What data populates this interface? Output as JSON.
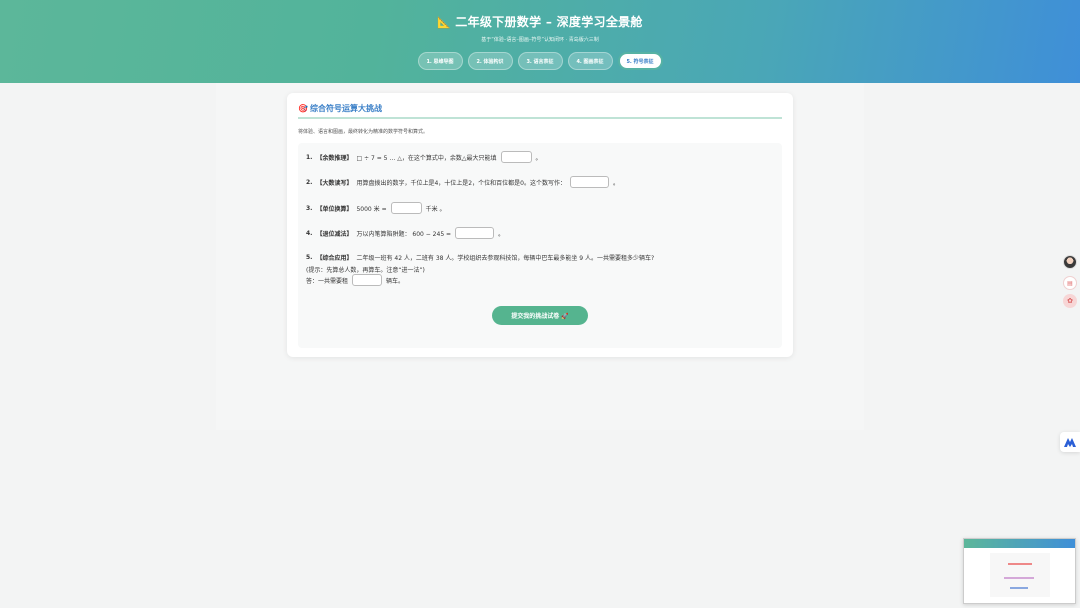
{
  "header": {
    "icon": "triangle-ruler-icon",
    "title": "二年级下册数学 – 深度学习全景舱",
    "subtitle": "基于“体验–语言–图画–符号”认知闭环 · 青岛版六三制"
  },
  "tabs": [
    {
      "label": "1. 思维导图"
    },
    {
      "label": "2. 体验构识"
    },
    {
      "label": "3. 语言表征"
    },
    {
      "label": "4. 图画表征"
    },
    {
      "label": "5. 符号表征"
    }
  ],
  "card": {
    "icon": "dart-icon",
    "title": "综合符号运算大挑战",
    "intro": "将体验、语言和图画，最终转化为精准的数学符号和算式。"
  },
  "questions": {
    "q1": {
      "num": "1.",
      "tag": "【余数推理】",
      "text": "□ ÷ 7 = 5 … △，在这个算式中，余数△最大只能填",
      "end": "。"
    },
    "q2": {
      "num": "2.",
      "tag": "【大数读写】",
      "text": "用算盘拨出的数字，千位上是4，十位上是2，个位和百位都是0。这个数写作：",
      "end": "。"
    },
    "q3": {
      "num": "3.",
      "tag": "【单位换算】",
      "text": "5000 米 =",
      "end": "千米 。"
    },
    "q4": {
      "num": "4.",
      "tag": "【退位减法】",
      "text": "万以内笔算陷阱题： 600 − 245 =",
      "end": "。"
    },
    "q5": {
      "num": "5.",
      "tag": "【综合应用】",
      "text": "二年级一班有 42 人，二班有 38 人。学校组织去参观科技馆，每辆中巴车最多能坐 9 人。一共需要租多少辆车?",
      "hint": "(提示：先算总人数，再算车。注意“进一法”)",
      "answer_prefix": "答：一共需要租",
      "answer_suffix": "辆车。"
    }
  },
  "submit_label": "提交我的挑战试卷 🚀",
  "sidebar": {
    "avatar": "avatar",
    "doc_icon": "doc-icon",
    "tool_icon": "toolbox-icon",
    "logo_icon": "brand-logo-icon"
  }
}
